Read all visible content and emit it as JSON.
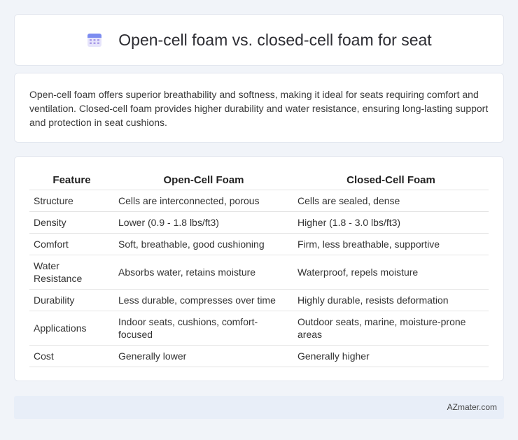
{
  "header": {
    "title": "Open-cell foam vs. closed-cell foam for seat",
    "icon": "calendar-icon"
  },
  "summary": {
    "text": "Open-cell foam offers superior breathability and softness, making it ideal for seats requiring comfort and ventilation. Closed-cell foam provides higher durability and water resistance, ensuring long-lasting support and protection in seat cushions."
  },
  "table": {
    "headers": [
      "Feature",
      "Open-Cell Foam",
      "Closed-Cell Foam"
    ],
    "rows": [
      [
        "Structure",
        "Cells are interconnected, porous",
        "Cells are sealed, dense"
      ],
      [
        "Density",
        "Lower (0.9 - 1.8 lbs/ft3)",
        "Higher (1.8 - 3.0 lbs/ft3)"
      ],
      [
        "Comfort",
        "Soft, breathable, good cushioning",
        "Firm, less breathable, supportive"
      ],
      [
        "Water Resistance",
        "Absorbs water, retains moisture",
        "Waterproof, repels moisture"
      ],
      [
        "Durability",
        "Less durable, compresses over time",
        "Highly durable, resists deformation"
      ],
      [
        "Applications",
        "Indoor seats, cushions, comfort-focused",
        "Outdoor seats, marine, moisture-prone areas"
      ],
      [
        "Cost",
        "Generally lower",
        "Generally higher"
      ]
    ]
  },
  "footer": {
    "brand": "AZmater.com"
  },
  "colors": {
    "page_background": "#f1f4f9",
    "card_background": "#ffffff",
    "footer_background": "#e8eef8"
  }
}
